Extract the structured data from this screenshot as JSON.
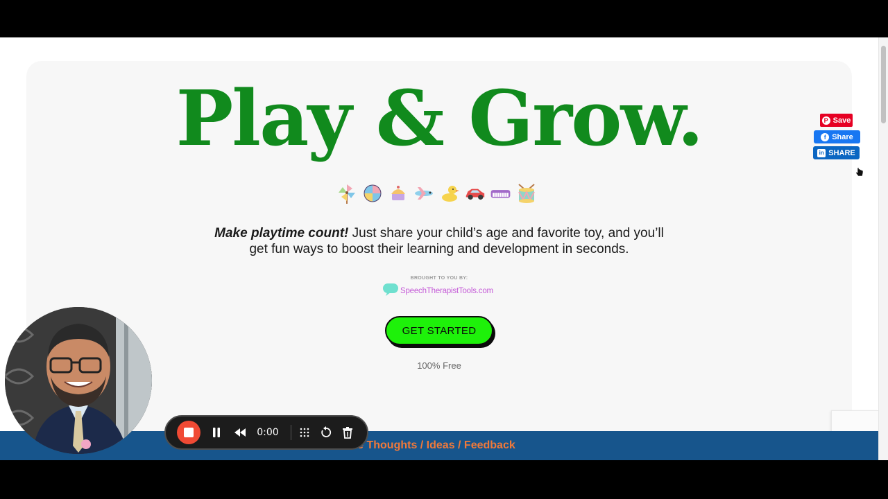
{
  "hero": {
    "title": "Play & Grow.",
    "toys": [
      "pinwheel-icon",
      "ball-icon",
      "cupcake-toy-icon",
      "plane-icon",
      "duck-icon",
      "car-icon",
      "keyboard-icon",
      "drum-icon"
    ]
  },
  "intro": {
    "emphasis": "Make playtime count!",
    "text": " Just share your child’s age and favorite toy, and you’ll get fun ways to boost their learning and development in seconds."
  },
  "sponsor": {
    "label": "BROUGHT TO YOU BY:",
    "brand": "SpeechTherapistTools.com"
  },
  "cta": {
    "label": "GET STARTED",
    "note": "100% Free"
  },
  "social": {
    "pinterest": "Save",
    "facebook": "Share",
    "linkedin": "SHARE"
  },
  "footer": {
    "text": "are Thoughts / Ideas / Feedback"
  },
  "recorder": {
    "time": "0:00"
  },
  "colors": {
    "title_green": "#118a1d",
    "cta_green": "#1ef10a",
    "footer_blue": "#17558c",
    "footer_orange": "#f0793a",
    "brand_purple": "#c45ad7",
    "record_red": "#f04a34"
  }
}
